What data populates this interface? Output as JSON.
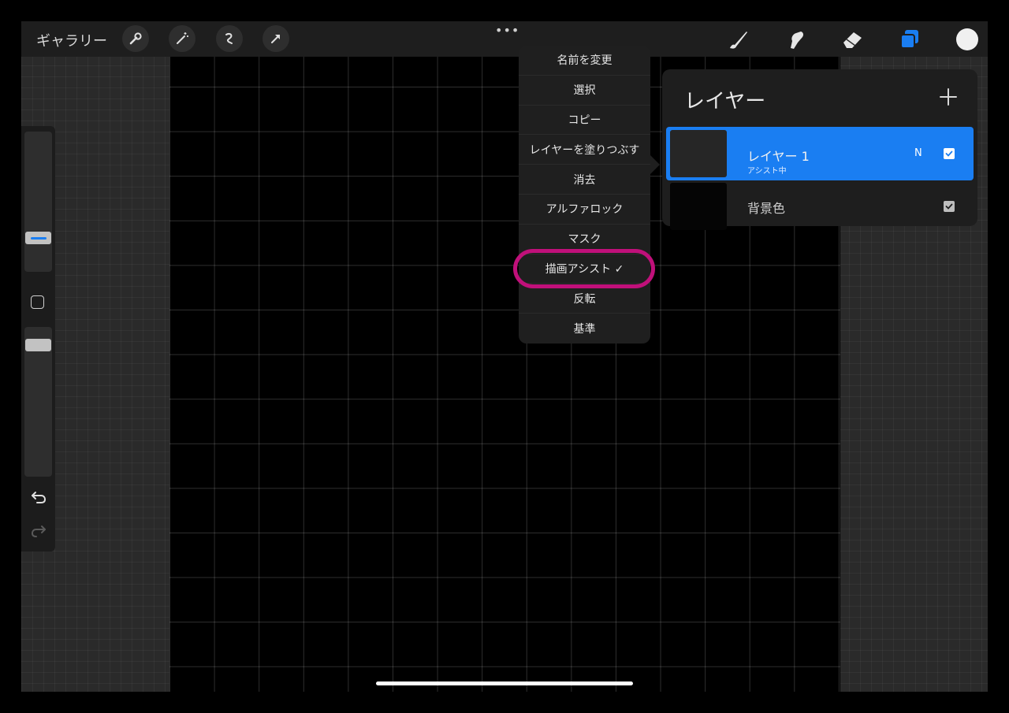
{
  "topbar": {
    "gallery_label": "ギャラリー",
    "more_label": "•••",
    "tools_left": [
      "wrench-icon",
      "magic-wand-icon",
      "selection-icon",
      "transform-arrow-icon"
    ],
    "tools_right": [
      "brush-icon",
      "smudge-icon",
      "eraser-icon",
      "layers-icon"
    ],
    "current_color": "#f0f0f0"
  },
  "layer_menu": {
    "items": [
      "名前を変更",
      "選択",
      "コピー",
      "レイヤーを塗りつぶす",
      "消去",
      "アルファロック",
      "マスク",
      "描画アシスト ✓",
      "反転",
      "基準"
    ],
    "highlight_color": "#c0107a"
  },
  "layers_panel": {
    "title": "レイヤー",
    "add_label": "+",
    "layers": [
      {
        "name": "レイヤー 1",
        "subtitle": "アシスト中",
        "blend": "N",
        "visible": true,
        "active": true
      },
      {
        "name": "背景色",
        "visible": true,
        "active": false
      }
    ],
    "accent": "#1a7ef2"
  },
  "sidebar": {
    "brush_size_level": 0.3,
    "opacity_level": 0.62
  }
}
